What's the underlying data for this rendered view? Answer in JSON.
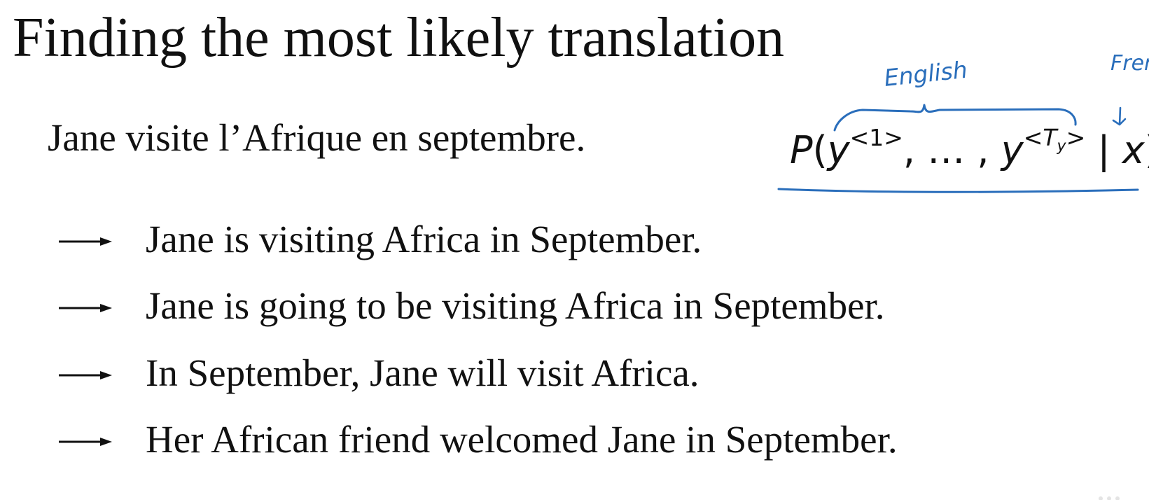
{
  "title": "Finding the most likely translation",
  "source_sentence": "Jane visite l’Afrique en septembre.",
  "formula": {
    "prob": "P",
    "open": "(",
    "y1_base": "y",
    "y1_sup": "<1>",
    "sep": ", … , ",
    "yT_base": "y",
    "yT_sup_open": "<",
    "yT_sup_T": "T",
    "yT_sup_sub": "y",
    "yT_sup_close": ">",
    "given": " | ",
    "x": "x",
    "close": ")"
  },
  "annotations": {
    "english_label": "English",
    "french_label": "French",
    "ink_color": "#2a6ebb"
  },
  "arrow_icon": "right-arrow-icon",
  "candidates": [
    "Jane is visiting Africa in September.",
    "Jane is going to be visiting Africa in September.",
    "In September, Jane will visit Africa.",
    "Her African friend welcomed Jane in September."
  ]
}
